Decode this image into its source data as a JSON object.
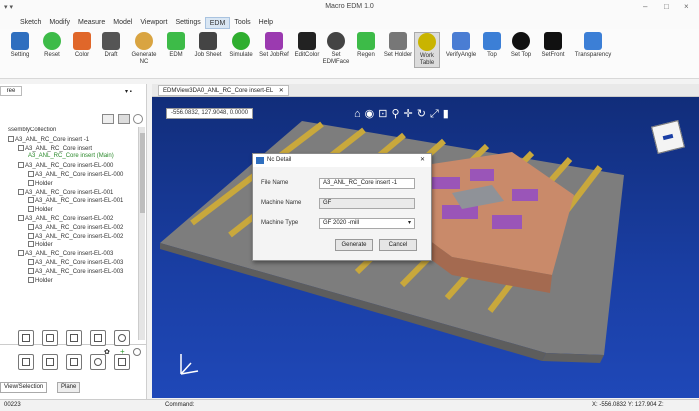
{
  "app": {
    "title": "Macro EDM 1.0",
    "quick_access": "▾ ▾"
  },
  "window_controls": [
    "–",
    "□",
    "×"
  ],
  "menu": [
    "Sketch",
    "Modify",
    "Measure",
    "Model",
    "Viewport",
    "Settings",
    "EDM",
    "Tools",
    "Help"
  ],
  "menu_active": "EDM",
  "ribbon": [
    {
      "label": "Setting",
      "icon": "gear-icon",
      "color": "#2f6fbf"
    },
    {
      "label": "Reset",
      "icon": "reset-icon",
      "color": "#3dbb48"
    },
    {
      "label": "Color",
      "icon": "color-icon",
      "color": "#e0672a"
    },
    {
      "label": "Draft",
      "icon": "draft-icon",
      "color": "#555555"
    },
    {
      "label": "Generate NC",
      "icon": "generate-nc-icon",
      "color": "#d9a441"
    },
    {
      "label": "EDM",
      "icon": "edm-icon",
      "color": "#3dbb48"
    },
    {
      "label": "Job Sheet",
      "icon": "printer-icon",
      "color": "#444444"
    },
    {
      "label": "Simulate",
      "icon": "play-icon",
      "color": "#2fae2f"
    },
    {
      "label": "Set JobRef",
      "icon": "set-jobref-icon",
      "color": "#9b3ab0"
    },
    {
      "label": "EditColor",
      "icon": "eye-icon",
      "color": "#222222"
    },
    {
      "label": "Set EDMFace",
      "icon": "set-edmface-icon",
      "color": "#444444"
    },
    {
      "label": "Regen",
      "icon": "regen-icon",
      "color": "#3dbb48"
    },
    {
      "label": "Set Holder",
      "icon": "set-holder-icon",
      "color": "#777777"
    },
    {
      "label": "Work Table",
      "icon": "worktable-icon",
      "color": "#c9b400"
    },
    {
      "label": "VerifyAngle",
      "icon": "verify-angle-icon",
      "color": "#4a7dd3"
    },
    {
      "label": "Top",
      "icon": "top-icon",
      "color": "#3c7fd6"
    },
    {
      "label": "Set Top",
      "icon": "arrow-down-icon",
      "color": "#111111"
    },
    {
      "label": "SetFront",
      "icon": "arrow-up-icon",
      "color": "#111111"
    },
    {
      "label": "Transparency",
      "icon": "transparency-icon",
      "color": "#3c7fd6"
    }
  ],
  "left_panel": {
    "tab": "ree",
    "tree": [
      {
        "text": "ssemblyCollection",
        "indent": 0,
        "cb": false,
        "green": false
      },
      {
        "text": "A3_ANL_RC_Core insert -1",
        "indent": 0,
        "cb": true,
        "green": false
      },
      {
        "text": "A3_ANL_RC_Core insert",
        "indent": 1,
        "cb": true,
        "green": false
      },
      {
        "text": "A3_ANL_RC_Core insert (Main)",
        "indent": 2,
        "cb": false,
        "green": true
      },
      {
        "text": "A3_ANL_RC_Core insert-EL-000",
        "indent": 1,
        "cb": true,
        "green": false
      },
      {
        "text": "A3_ANL_RC_Core insert-EL-000",
        "indent": 2,
        "cb": true,
        "green": false
      },
      {
        "text": "Holder",
        "indent": 2,
        "cb": true,
        "green": false
      },
      {
        "text": "A3_ANL_RC_Core insert-EL-001",
        "indent": 1,
        "cb": true,
        "green": false
      },
      {
        "text": "A3_ANL_RC_Core insert-EL-001",
        "indent": 2,
        "cb": true,
        "green": false
      },
      {
        "text": "Holder",
        "indent": 2,
        "cb": true,
        "green": false
      },
      {
        "text": "A3_ANL_RC_Core insert-EL-002",
        "indent": 1,
        "cb": true,
        "green": false
      },
      {
        "text": "A3_ANL_RC_Core insert-EL-002",
        "indent": 2,
        "cb": true,
        "green": false
      },
      {
        "text": "A3_ANL_RC_Core insert-EL-002",
        "indent": 2,
        "cb": true,
        "green": false
      },
      {
        "text": "Holder",
        "indent": 2,
        "cb": true,
        "green": false
      },
      {
        "text": "A3_ANL_RC_Core insert-EL-003",
        "indent": 1,
        "cb": true,
        "green": false
      },
      {
        "text": "A3_ANL_RC_Core insert-EL-003",
        "indent": 2,
        "cb": true,
        "green": false
      },
      {
        "text": "A3_ANL_RC_Core insert-EL-003",
        "indent": 2,
        "cb": true,
        "green": false
      },
      {
        "text": "Holder",
        "indent": 2,
        "cb": true,
        "green": false
      }
    ],
    "bottom_tabs": [
      "View/Selection",
      "Plane"
    ]
  },
  "view_tab": "EDMView3DA0_ANL_RC_Core insert-EL",
  "coord_readout": "-556.0832, 127.9048, 0.0000",
  "dialog": {
    "title": "Nc Detail",
    "fields": [
      {
        "label": "File Name",
        "value": "A3_ANL_RC_Core insert -1"
      },
      {
        "label": "Machine Name",
        "value": "GF"
      },
      {
        "label": "Machine Type",
        "value": "GF 2020 -mill"
      }
    ],
    "buttons": [
      "Generate",
      "Cancel"
    ]
  },
  "status": {
    "left": "00223",
    "command_label": "Command:",
    "coords": "X: -556.0832 Y: 127.904 Z:"
  }
}
